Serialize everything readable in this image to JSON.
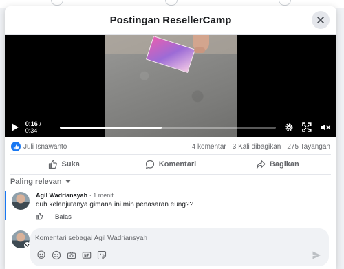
{
  "modal": {
    "title": "Postingan ResellerCamp"
  },
  "video": {
    "current_time": "0:16",
    "duration": "0:34",
    "progress_fraction": 0.47
  },
  "stats": {
    "reactor": "Juli Isnawanto",
    "comments": "4 komentar",
    "shares": "3 Kali dibagikan",
    "views": "275 Tayangan"
  },
  "actions": {
    "like": "Suka",
    "comment": "Komentari",
    "share": "Bagikan"
  },
  "sort": {
    "label": "Paling relevan"
  },
  "comment": {
    "author": "Agil Wadriansyah",
    "separator": "·",
    "time": "1 menit",
    "text": "duh kelanjutanya gimana ini min penasaran eung??",
    "reply": "Balas"
  },
  "composer": {
    "placeholder": "Komentari sebagai Agil Wadriansyah"
  },
  "colors": {
    "accent": "#1877f2",
    "text": "#1c1e21",
    "secondary_text": "#65676b"
  }
}
